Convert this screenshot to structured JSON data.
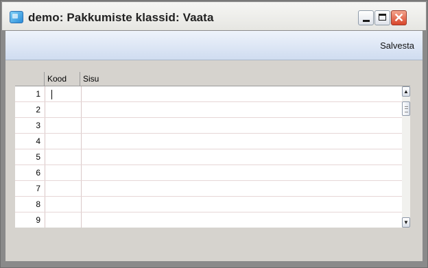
{
  "window": {
    "title": "demo: Pakkumiste klassid: Vaata",
    "close_glyph": "✕"
  },
  "toolbar": {
    "save_label": "Salvesta"
  },
  "grid": {
    "columns": [
      "",
      "Kood",
      "Sisu"
    ],
    "rows": [
      {
        "num": "1",
        "kood": "",
        "sisu": ""
      },
      {
        "num": "2",
        "kood": "",
        "sisu": ""
      },
      {
        "num": "3",
        "kood": "",
        "sisu": ""
      },
      {
        "num": "4",
        "kood": "",
        "sisu": ""
      },
      {
        "num": "5",
        "kood": "",
        "sisu": ""
      },
      {
        "num": "6",
        "kood": "",
        "sisu": ""
      },
      {
        "num": "7",
        "kood": "",
        "sisu": ""
      },
      {
        "num": "8",
        "kood": "",
        "sisu": ""
      },
      {
        "num": "9",
        "kood": "",
        "sisu": ""
      }
    ]
  },
  "scrollbar": {
    "up_glyph": "▲",
    "down_glyph": "▼"
  }
}
